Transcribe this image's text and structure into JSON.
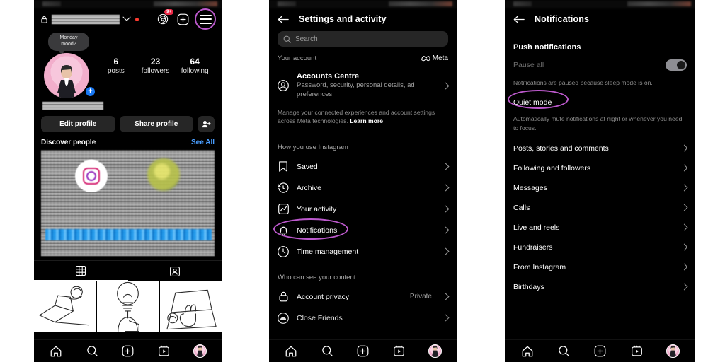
{
  "phone1": {
    "name": "instagram-profile-screen",
    "topbar": {
      "username_masked": "",
      "lock_icon": "lock-icon",
      "chevron": "chevron-down-icon",
      "threads_icon": "threads-icon",
      "threads_badge": "9+",
      "add_icon": "plus-square-icon",
      "menu_icon": "hamburger-menu-icon"
    },
    "note": "Monday mood?",
    "avatar_add": "+",
    "stats": [
      {
        "num": "6",
        "label": "posts"
      },
      {
        "num": "23",
        "label": "followers"
      },
      {
        "num": "64",
        "label": "following"
      }
    ],
    "buttons": {
      "edit_profile": "Edit profile",
      "share_profile": "Share profile",
      "add_people": "add-person-icon"
    },
    "discover": {
      "title": "Discover people",
      "see_all": "See All"
    },
    "tabs": [
      {
        "name": "grid-tab",
        "icon": "grid-icon",
        "active": true
      },
      {
        "name": "tagged-tab",
        "icon": "tagged-person-icon",
        "active": false
      }
    ],
    "tabbar": [
      "home-icon",
      "search-icon",
      "create-icon",
      "reels-icon",
      "profile-avatar"
    ]
  },
  "phone2": {
    "name": "settings-and-activity-screen",
    "header": {
      "back": "back-arrow-icon",
      "title": "Settings and activity"
    },
    "search": {
      "placeholder": "Search",
      "icon": "search-icon"
    },
    "sections": [
      {
        "label": "Your account",
        "badge": "Meta",
        "rows": [
          {
            "icon": "account-circle-icon",
            "title": "Accounts Centre",
            "sub": "Password, security, personal details, ad preferences",
            "chevron": true
          }
        ],
        "helper_text": "Manage your connected experiences and account settings across Meta technologies. ",
        "helper_link": "Learn more"
      },
      {
        "label": "How you use Instagram",
        "rows": [
          {
            "icon": "bookmark-icon",
            "title": "Saved",
            "chevron": true
          },
          {
            "icon": "archive-clock-icon",
            "title": "Archive",
            "chevron": true
          },
          {
            "icon": "activity-chart-icon",
            "title": "Your activity",
            "chevron": true
          },
          {
            "icon": "bell-icon",
            "title": "Notifications",
            "chevron": true,
            "highlighted": true
          },
          {
            "icon": "clock-icon",
            "title": "Time management",
            "chevron": true
          }
        ]
      },
      {
        "label": "Who can see your content",
        "rows": [
          {
            "icon": "lock-icon",
            "title": "Account privacy",
            "value": "Private",
            "chevron": true
          },
          {
            "icon": "close-friends-icon",
            "title": "Close Friends",
            "chevron": true
          }
        ]
      }
    ],
    "tabbar": [
      "home-icon",
      "search-icon",
      "create-icon",
      "reels-icon",
      "profile-avatar"
    ]
  },
  "phone3": {
    "name": "notifications-settings-screen",
    "header": {
      "back": "back-arrow-icon",
      "title": "Notifications"
    },
    "section_title": "Push notifications",
    "pause_all": {
      "label": "Pause all",
      "toggle_on": false
    },
    "pause_helper": "Notifications are paused because sleep mode is on.",
    "quiet_mode": {
      "label": "Quiet mode",
      "highlighted": true
    },
    "quiet_helper": "Automatically mute notifications at night or whenever you need to focus.",
    "rows": [
      {
        "title": "Posts, stories and comments",
        "chevron": true
      },
      {
        "title": "Following and followers",
        "chevron": true
      },
      {
        "title": "Messages",
        "chevron": true
      },
      {
        "title": "Calls",
        "chevron": true
      },
      {
        "title": "Live and reels",
        "chevron": true
      },
      {
        "title": "Fundraisers",
        "chevron": true
      },
      {
        "title": "From Instagram",
        "chevron": true
      },
      {
        "title": "Birthdays",
        "chevron": true
      }
    ],
    "tabbar": [
      "home-icon",
      "search-icon",
      "create-icon",
      "reels-icon",
      "profile-avatar"
    ]
  },
  "colors": {
    "highlight": "#bc59cc",
    "background": "#000000",
    "link": "#4a9eff",
    "badge": "#ed2a47",
    "add_badge": "#1877f2"
  }
}
